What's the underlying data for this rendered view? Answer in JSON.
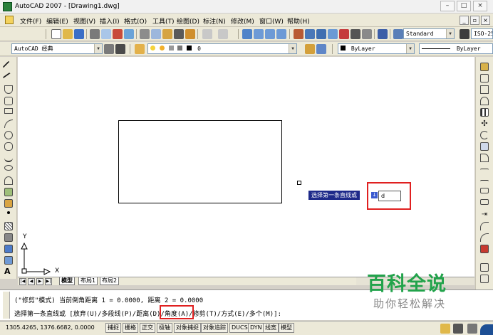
{
  "titlebar": {
    "title": "AutoCAD 2007 - [Drawing1.dwg]",
    "minimize": "–",
    "maximize": "□",
    "close": "×"
  },
  "menubar": {
    "items": [
      "文件(F)",
      "编辑(E)",
      "视图(V)",
      "插入(I)",
      "格式(O)",
      "工具(T)",
      "绘图(D)",
      "标注(N)",
      "修改(M)",
      "窗口(W)",
      "帮助(H)"
    ],
    "mdi_minimize": "_",
    "mdi_restore": "▫",
    "mdi_close": "×"
  },
  "toolbar1": {
    "text_style": "Standard",
    "dim_style": "ISO-25"
  },
  "toolbar2": {
    "workspace": "AutoCAD 经典",
    "layer": "0",
    "color": "ByLayer",
    "linetype": "ByLayer"
  },
  "canvas": {
    "ucs_x_label": "X",
    "ucs_y_label": "Y"
  },
  "tabs": {
    "items": [
      "模型",
      "布局1",
      "布局2"
    ]
  },
  "dynamic_input": {
    "prompt": "选择第一条直线或",
    "value": "d"
  },
  "command": {
    "line1": "(\"修剪\"模式) 当前倒角距离 1 = 0.0000, 距离 2 = 0.0000",
    "line2_before": "选择第一条直线或 [放弃(U)/多段线(P)/",
    "line2_highlight": "距离(D)",
    "line2_after": "/角度(A)/修剪(T)/方式(E)/多个(M)]:"
  },
  "statusbar": {
    "coords": "1305.4265, 1376.6682, 0.0000",
    "buttons": [
      "捕捉",
      "栅格",
      "正交",
      "极轴",
      "对象捕捉",
      "对象追踪",
      "DUCS",
      "DYN",
      "线宽",
      "模型"
    ]
  },
  "watermark": {
    "brand": "百科全说",
    "tagline": "助你轻松解决"
  },
  "colors": {
    "highlight_box": "#e02020",
    "watermark_green": "#22a34b"
  }
}
